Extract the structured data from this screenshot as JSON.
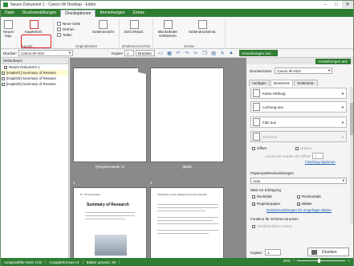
{
  "window": {
    "title": "Neues Dokument 1 - Canon iW Desktop - Editor"
  },
  "menu": {
    "tabs": [
      "Datei",
      "Druckeinstellungen",
      "Druckoptionen",
      "Anmerkungen",
      "Extras"
    ]
  },
  "ribbon": {
    "group_kapitel": "Kapitel",
    "group_originalseiten": "Originalseiten",
    "group_inhaltsverzeichnis": "Inhaltsverzeichnis",
    "group_extras": "Extras",
    "neues_kap_line1": "Neues",
    "neues_kap_line2": "Kap.",
    "kapitelvorlage": "Kapitelvorl.",
    "neue_seite": "Neue Seite",
    "drehen": "Drehen",
    "teilen": "Teilen",
    "seitenansicht": "Seitenansicht",
    "einf_aktual": "Einf./Aktual.",
    "blockraender_line1": "Blockränder",
    "blockraender_line2": "verkleinern",
    "seitendruckeinst": "Seitendruckeinst."
  },
  "toolbar": {
    "drucker_label": "Drucker:",
    "drucker_value": "Canon iR-ADV",
    "kopien_label": "Kopien",
    "kopien_value": "1",
    "drucken_label": "Drucken",
    "anmerkungen_btn": "Anmerkungen anz."
  },
  "sidebar": {
    "header": "Seitenbaum",
    "items": [
      {
        "label": "Neues Dokument 1"
      },
      {
        "label": "[Kapitel1] Summary of Researc"
      },
      {
        "label": "[Kapitel2] Summary of Researc"
      },
      {
        "label": "[Kapitel3] Summary of Researc"
      }
    ]
  },
  "canvas": {
    "page1_caption": "(Registerpapier 1)",
    "page2_caption": "(Blatt)",
    "page3_num": "1",
    "page4_num": "2",
    "doc_title": "Summary of Research",
    "doc_header": "Dr. XX Corporation",
    "doc2_header": "Introduction of the background of this research"
  },
  "right_panel": {
    "druckername_label": "Druckername:",
    "druckername_value": "Canon iR-ADV",
    "tabs": [
      "Vorlagen",
      "Druckerst.",
      "Seitenerst."
    ],
    "heftung": "Keine Heftung",
    "lochung": "Lochung aus",
    "falz": "Falz aus",
    "sortieren": "Sortieren",
    "offset": "Offset",
    "drehen": "Drehen",
    "anzahl_kopien": "Anzahl der Kopien für Offset",
    "anzahl_value": "1",
    "finishing_optionen": "Finishing-Optionen",
    "papierquelle_label": "Papierquelleneinstellungen",
    "papierquelle_value": "Auto",
    "blatt_label": "Blatt zur Einfügung",
    "deckblatt": "Deckblatt",
    "rueckenblatt": "Rückenblatt",
    "registerpapier": "Registerpapier",
    "blaetter": "Blätter",
    "detail_link": "Detaileinstellungen für eingefügte Blätter",
    "sicheres_drucken": "Funktion für sicheres Drucken",
    "geraet_label": "Gerätefunktion nutzen",
    "kopien_label": "Kopien:",
    "kopien_value": "1",
    "drucken_btn": "Drucken"
  },
  "statusbar": {
    "ausgewaehlte_seite": "Ausgewählte Seite 1/33",
    "ausgabeformat": "Ausgabeformat:A4",
    "blaetter_gesamt": "Blätter gesamt: 39",
    "zoom_value": "25%",
    "zoom_fraction": 0.42
  },
  "colors": {
    "accent": "#2f7d32",
    "highlight": "#e02020",
    "link": "#1a5fb4"
  }
}
